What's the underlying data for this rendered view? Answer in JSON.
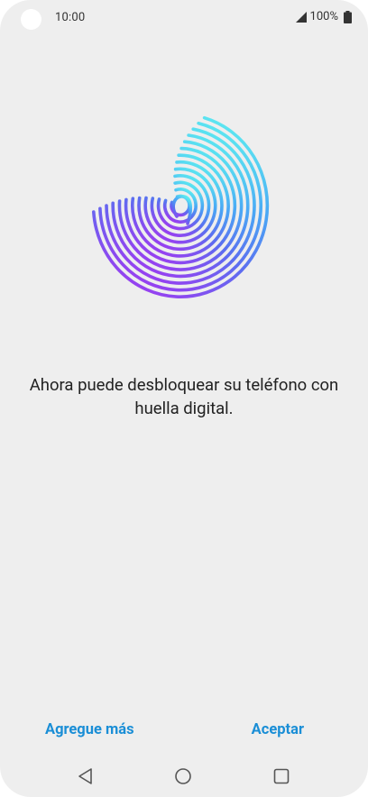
{
  "status_bar": {
    "time": "10:00",
    "battery_text": "100%",
    "icons": [
      "camera-cutout",
      "signal-icon",
      "battery-icon"
    ]
  },
  "main": {
    "illustration": "fingerprint-icon",
    "gradient_colors": [
      "#5ef0f0",
      "#4aa8f5",
      "#5b6ff0",
      "#9a3ef0"
    ],
    "message": "Ahora puede desbloquear su teléfono con huella digital."
  },
  "actions": {
    "add_more_label": "Agregue más",
    "accept_label": "Aceptar",
    "accent_color": "#1a8ed6"
  },
  "nav_bar": {
    "icons": [
      "back-icon",
      "home-icon",
      "recents-icon"
    ]
  }
}
